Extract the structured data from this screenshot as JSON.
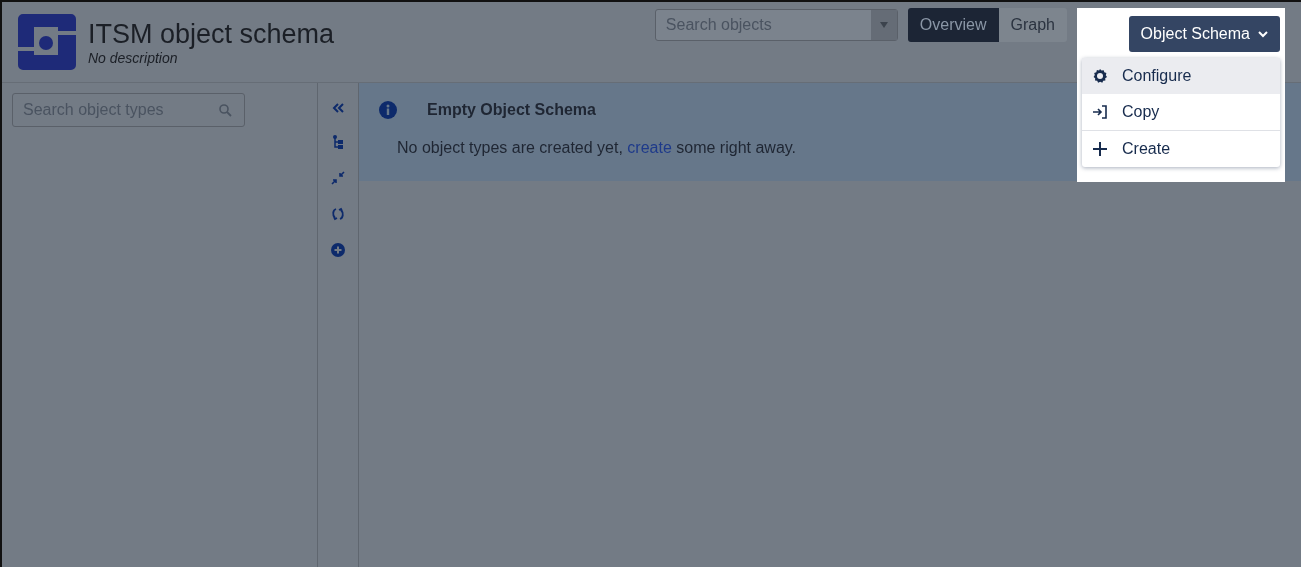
{
  "header": {
    "title": "ITSM object schema",
    "description": "No description"
  },
  "search_objects": {
    "placeholder": "Search objects"
  },
  "tabs": [
    {
      "label": "Overview",
      "selected": true
    },
    {
      "label": "Graph",
      "selected": false
    }
  ],
  "object_schema_menu": {
    "label": "Object Schema",
    "expanded": true,
    "groups": [
      [
        {
          "label": "Configure",
          "kind": "gear",
          "selected": true
        },
        {
          "label": "Copy",
          "kind": "enter",
          "selected": false
        }
      ],
      [
        {
          "label": "Create",
          "kind": "plus",
          "selected": false
        }
      ]
    ]
  },
  "sidebar": {
    "search": {
      "placeholder": "Search object types"
    }
  },
  "toolbar": [
    {
      "kind": "collapse"
    },
    {
      "kind": "tree"
    },
    {
      "kind": "shrink"
    },
    {
      "kind": "refresh"
    },
    {
      "kind": "add"
    }
  ],
  "message": {
    "title": "Empty Object Schema",
    "text_before": "No object types are created yet,",
    "link": "create",
    "text_after": "some right away."
  }
}
